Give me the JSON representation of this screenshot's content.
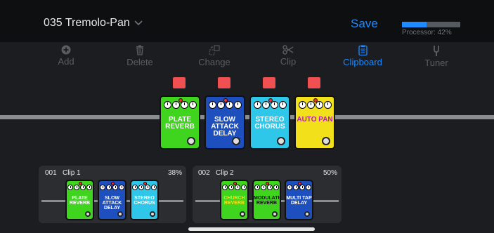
{
  "header": {
    "preset_name": "035 Tremolo-Pan",
    "save_label": "Save",
    "processor_label": "Processor: 42%",
    "processor_fraction": 0.42,
    "accent_color": "#1f8bff"
  },
  "toolbar": {
    "items": [
      {
        "label": "Add",
        "icon": "plus-circle-icon",
        "active": false
      },
      {
        "label": "Delete",
        "icon": "trash-icon",
        "active": false
      },
      {
        "label": "Change",
        "icon": "change-icon",
        "active": false
      },
      {
        "label": "Clip",
        "icon": "scissors-icon",
        "active": false
      },
      {
        "label": "Clipboard",
        "icon": "clipboard-icon",
        "active": true
      },
      {
        "label": "Tuner",
        "icon": "tuning-fork-icon",
        "active": false
      }
    ]
  },
  "chain": {
    "pedals": [
      {
        "name": "PLATE REVERB",
        "line1": "PLATE",
        "line2": "REVERB",
        "color": "#3fd51f",
        "text_color": "#ffffff"
      },
      {
        "name": "SLOW ATTACK DELAY",
        "line1": "SLOW ATTACK",
        "line2": "DELAY",
        "color": "#1e4fbf",
        "text_color": "#ffffff"
      },
      {
        "name": "STEREO CHORUS",
        "line1": "STEREO",
        "line2": "CHORUS",
        "color": "#2ec7ea",
        "text_color": "#ffffff"
      },
      {
        "name": "AUTO PAN",
        "line1": "AUTO PAN",
        "line2": "",
        "color": "#f2e11a",
        "text_color": "#b51bb5"
      }
    ]
  },
  "clips": [
    {
      "number": "001",
      "name": "Clip 1",
      "percent": "38%",
      "pedals": [
        {
          "line1": "PLATE",
          "line2": "REVERB",
          "color": "#3fd51f",
          "text_color": "#ffffff"
        },
        {
          "line1": "SLOW ATTACK",
          "line2": "DELAY",
          "color": "#1e4fbf",
          "text_color": "#ffffff"
        },
        {
          "line1": "STEREO",
          "line2": "CHORUS",
          "color": "#2ec7ea",
          "text_color": "#ffffff"
        }
      ]
    },
    {
      "number": "002",
      "name": "Clip 2",
      "percent": "50%",
      "pedals": [
        {
          "line1": "CHURCH",
          "line2": "REVERB",
          "color": "#3fd51f",
          "text_color": "#f2e11a"
        },
        {
          "line1": "MODULATION",
          "line2": "REVERB",
          "color": "#3fd51f",
          "text_color": "#111111"
        },
        {
          "line1": "MULTI TAP DELAY",
          "line2": "",
          "color": "#1e4fbf",
          "text_color": "#ffffff"
        }
      ]
    }
  ]
}
